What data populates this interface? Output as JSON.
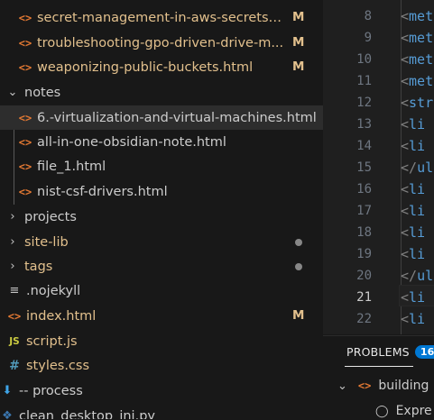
{
  "colors": {
    "modified_file": "#e2c08d",
    "untracked_folder": "#cccccc",
    "html_icon": "#e37933",
    "accent": "#0078d4"
  },
  "explorer": {
    "items": [
      {
        "label": "secret-management-in-aws-secrets-...",
        "icon": "html-icon",
        "badge": "M",
        "modified": true
      },
      {
        "label": "troubleshooting-gpo-driven-drive-m...",
        "icon": "html-icon",
        "badge": "M",
        "modified": true
      },
      {
        "label": "weaponizing-public-buckets.html",
        "icon": "html-icon",
        "badge": "M",
        "modified": true
      },
      {
        "label": "notes",
        "icon": "chevron-down-icon",
        "folder": true
      },
      {
        "label": "6.-virtualization-and-virtual-machines.html",
        "icon": "html-icon",
        "selected": true
      },
      {
        "label": "all-in-one-obsidian-note.html",
        "icon": "html-icon"
      },
      {
        "label": "file_1.html",
        "icon": "html-icon"
      },
      {
        "label": "nist-csf-drivers.html",
        "icon": "html-icon"
      },
      {
        "label": "projects",
        "icon": "chevron-right-icon",
        "folder": true
      },
      {
        "label": "site-lib",
        "icon": "chevron-right-icon",
        "folder": true,
        "dot": true,
        "modified": true
      },
      {
        "label": "tags",
        "icon": "chevron-right-icon",
        "folder": true,
        "dot": true,
        "modified": true
      },
      {
        "label": ".nojekyll",
        "icon": "lines-icon"
      },
      {
        "label": "index.html",
        "icon": "html-icon",
        "badge": "M",
        "modified": true
      },
      {
        "label": "script.js",
        "icon": "js-icon",
        "modified": true
      },
      {
        "label": "styles.css",
        "icon": "css-icon",
        "modified": true
      },
      {
        "label": "-- process",
        "icon": "download-icon"
      },
      {
        "label": "clean_desktop_ini.py",
        "icon": "python-icon"
      }
    ]
  },
  "editor": {
    "line_numbers": [
      "8",
      "9",
      "10",
      "11",
      "12",
      "13",
      "14",
      "15",
      "16",
      "17",
      "18",
      "19",
      "20",
      "21",
      "22"
    ],
    "active_line": "21",
    "code_lines": [
      "<met",
      "<met",
      "<met",
      "<met",
      "<str",
      "<li",
      "<li",
      "</ul",
      "<li",
      "<li",
      "<li",
      "<li",
      "</ul",
      "<li",
      "<li"
    ]
  },
  "panel": {
    "tab_label": "PROBLEMS",
    "problem_count": "16",
    "group_label": "building",
    "problem_text": "Expre"
  }
}
